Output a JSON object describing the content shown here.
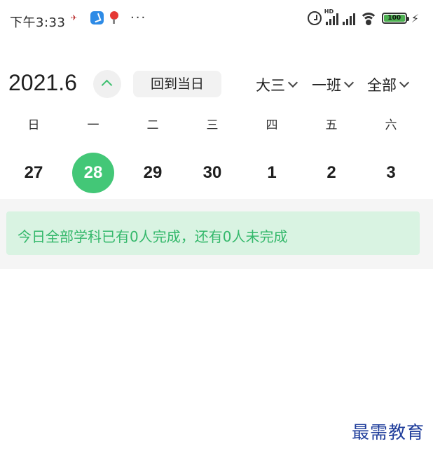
{
  "status_bar": {
    "time": "下午3:33",
    "more": "···",
    "battery": "100",
    "left_icons": [
      "app-icon",
      "feishu-icon",
      "location-pin-icon",
      "more-icon"
    ],
    "right_icons": [
      "alarm-icon",
      "hd-signal-icon",
      "signal-icon",
      "wifi-icon",
      "battery-icon",
      "charging-icon"
    ]
  },
  "header": {
    "month": "2021.6",
    "today_button": "回到当日",
    "filters": [
      "大三",
      "一班",
      "全部"
    ]
  },
  "week": {
    "weekdays": [
      "日",
      "一",
      "二",
      "三",
      "四",
      "五",
      "六"
    ],
    "days": [
      "27",
      "28",
      "29",
      "30",
      "1",
      "2",
      "3"
    ],
    "selected_day": "28"
  },
  "summary": {
    "text": "今日全部学科已有0人完成，还有0人未完成"
  },
  "watermark": "最需教育",
  "colors": {
    "accent": "#43c777",
    "summary_bg": "#d9f3e2",
    "summary_text": "#34b86b",
    "watermark": "#1f3d9b"
  }
}
